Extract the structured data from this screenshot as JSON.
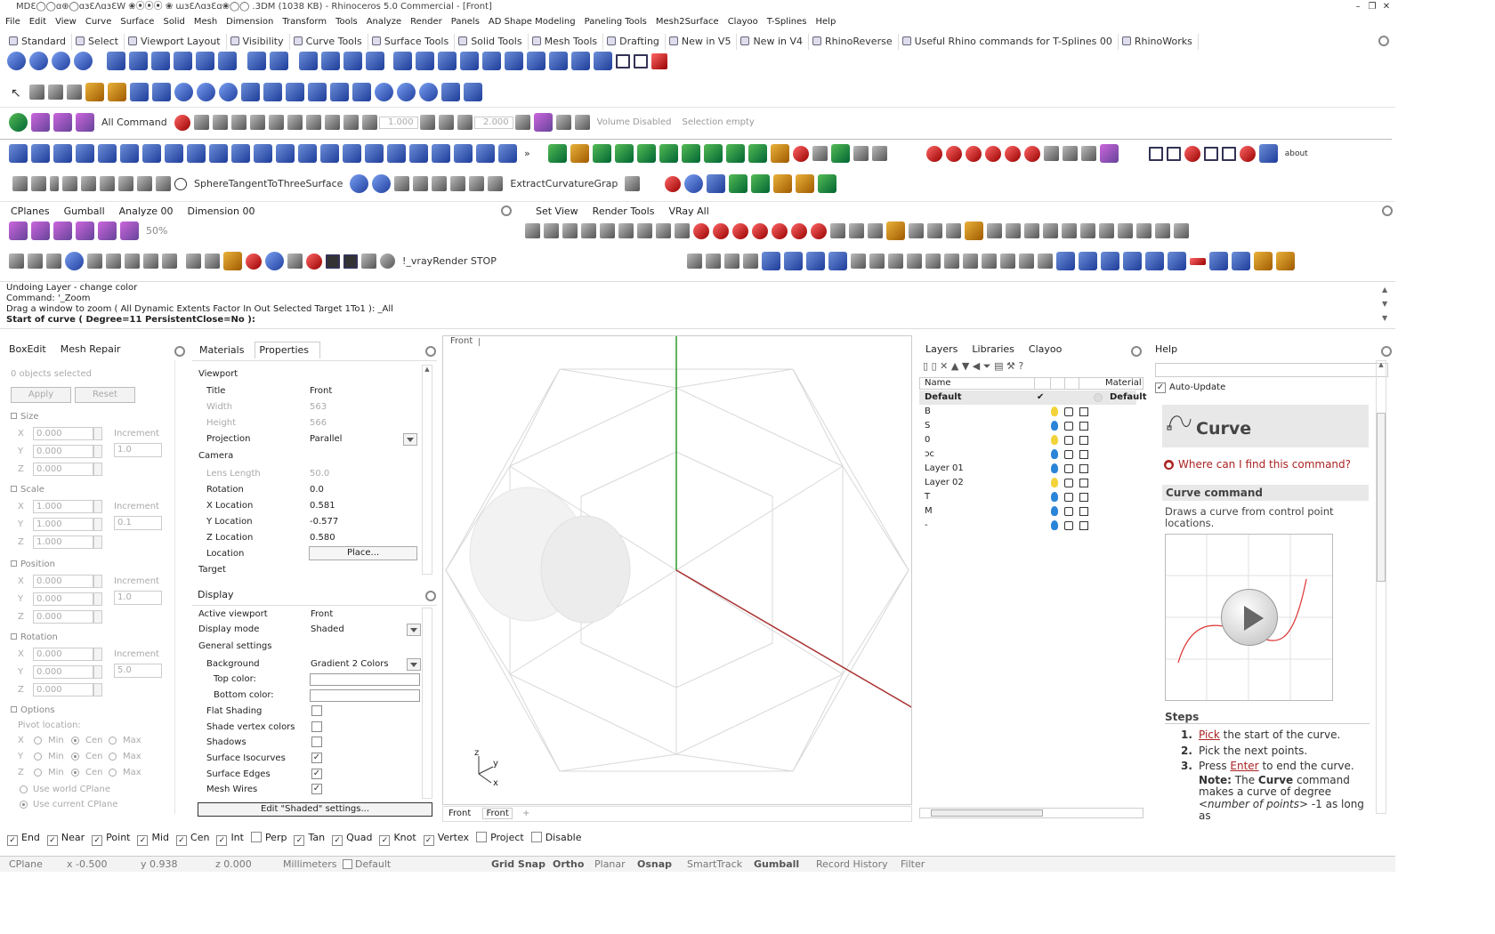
{
  "window": {
    "title": "MDƐ◯◯ɑ⊕◯ɑɜƐΛɑɜƐW ❀⦿⦿⦿ ❀ ɯɜƐΛɑɜƐɑ❀◯◯ .3DM  (1038 KB) - Rhinoceros 5.0 Commercial - [Front]",
    "minimize": "–",
    "maximize": "❐",
    "close": "✕"
  },
  "menu": [
    "File",
    "Edit",
    "View",
    "Curve",
    "Surface",
    "Solid",
    "Mesh",
    "Dimension",
    "Transform",
    "Tools",
    "Analyze",
    "Render",
    "Panels",
    "AD Shape Modeling",
    "Paneling Tools",
    "Mesh2Surface",
    "Clayoo",
    "T-Splines",
    "Help"
  ],
  "toolbar_tabs": [
    "Standard",
    "Select",
    "Viewport Layout",
    "Visibility",
    "Curve Tools",
    "Surface Tools",
    "Solid Tools",
    "Mesh Tools",
    "Drafting",
    "New in V5",
    "New in V4",
    "RhinoReverse",
    "Useful Rhino commands for T-Splines 00",
    "RhinoWorks"
  ],
  "toolbar_text": {
    "all_command": "All Command",
    "val_1000": "1.000",
    "val_2000": "2.000",
    "volume": "Volume Disabled",
    "selection": "Selection empty",
    "sphere_tangent": "SphereTangentToThreeSurface",
    "extract": "ExtractCurvatureGrap",
    "about": "about",
    "percent": "50%",
    "vray_stop": "!_vrayRender STOP"
  },
  "secondary_tabs_left": [
    "CPlanes",
    "Gumball",
    "Analyze 00",
    "Dimension 00"
  ],
  "secondary_tabs_right": [
    "Set View",
    "Render Tools",
    "VRay All"
  ],
  "command_history": [
    "Undoing Layer - change color",
    "Command: '_Zoom",
    "Drag a window to zoom ( All  Dynamic  Extents  Factor  In  Out  Selected  Target  1To1 ): _All",
    "Start of curve ( Degree=11  PersistentClose=No ):"
  ],
  "left_panel": {
    "tabs": [
      "BoxEdit",
      "Mesh Repair"
    ],
    "selected": "0 objects selected",
    "apply": "Apply",
    "reset": "Reset",
    "size": "Size",
    "scale": "Scale",
    "position": "Position",
    "rotation": "Rotation",
    "options": "Options",
    "increment": "Increment",
    "x": "X",
    "y": "Y",
    "z": "Z",
    "size_vals": [
      "0.000",
      "0.000",
      "0.000"
    ],
    "size_inc": "1.0",
    "scale_vals": [
      "1.000",
      "1.000",
      "1.000"
    ],
    "scale_inc": "0.1",
    "pos_vals": [
      "0.000",
      "0.000",
      "0.000"
    ],
    "pos_inc": "1.0",
    "rot_vals": [
      "0.000",
      "0.000",
      "0.000"
    ],
    "rot_inc": "5.0",
    "pivot": "Pivot location:",
    "min": "Min",
    "cen": "Cen",
    "max": "Max",
    "world": "Use world CPlane",
    "current": "Use current CPlane"
  },
  "properties_panel": {
    "tabs": [
      "Materials",
      "Properties"
    ],
    "viewport_header": "Viewport",
    "rows": [
      {
        "k": "Title",
        "v": "Front",
        "dis": false
      },
      {
        "k": "Width",
        "v": "563",
        "dis": true
      },
      {
        "k": "Height",
        "v": "566",
        "dis": true
      },
      {
        "k": "Projection",
        "v": "Parallel",
        "dis": false
      }
    ],
    "camera_header": "Camera",
    "camera_rows": [
      {
        "k": "Lens Length",
        "v": "50.0",
        "dis": true
      },
      {
        "k": "Rotation",
        "v": "0.0",
        "dis": false
      },
      {
        "k": "X Location",
        "v": "0.581",
        "dis": false
      },
      {
        "k": "Y Location",
        "v": "-0.577",
        "dis": false
      },
      {
        "k": "Z Location",
        "v": "0.580",
        "dis": false
      }
    ],
    "location": "Location",
    "place_btn": "Place...",
    "target": "Target"
  },
  "display_panel": {
    "tab": "Display",
    "active_viewport_k": "Active viewport",
    "active_viewport_v": "Front",
    "display_mode_k": "Display mode",
    "display_mode_v": "Shaded",
    "general": "General settings",
    "background_k": "Background",
    "background_v": "Gradient 2 Colors",
    "top_color": "Top color:",
    "bottom_color": "Bottom color:",
    "checks": [
      {
        "label": "Flat Shading",
        "on": false
      },
      {
        "label": "Shade vertex colors",
        "on": false
      },
      {
        "label": "Shadows",
        "on": false
      },
      {
        "label": "Surface Isocurves",
        "on": true
      },
      {
        "label": "Surface Edges",
        "on": true
      },
      {
        "label": "Mesh Wires",
        "on": true
      }
    ],
    "edit_btn": "Edit \"Shaded\" settings..."
  },
  "viewport": {
    "label": "Front",
    "tab1": "Front",
    "tab2": "Front",
    "add": "+",
    "axis_x": "x",
    "axis_y": "y",
    "axis_z": "z"
  },
  "layers_panel": {
    "tabs": [
      "Layers",
      "Libraries",
      "Clayoo"
    ],
    "col_name": "Name",
    "col_material": "Material",
    "default_name": "Default",
    "default_material": "Default",
    "check": "✔",
    "layers": [
      {
        "name": "B",
        "bulb": "#f2d33a"
      },
      {
        "name": "S",
        "bulb": "#2a84d8"
      },
      {
        "name": "0",
        "bulb": "#f2d33a"
      },
      {
        "name": "ɔc",
        "bulb": "#2a84d8"
      },
      {
        "name": "Layer 01",
        "bulb": "#2a84d8"
      },
      {
        "name": "Layer 02",
        "bulb": "#f2d33a"
      },
      {
        "name": "T",
        "bulb": "#2a84d8"
      },
      {
        "name": "M",
        "bulb": "#2a84d8"
      },
      {
        "name": "-",
        "bulb": "#2a84d8"
      }
    ]
  },
  "help_panel": {
    "tab": "Help",
    "auto_update": "Auto-Update",
    "title": "Curve",
    "where": "Where can I find this command?",
    "cmd_header": "Curve command",
    "desc": "Draws a curve from control point locations.",
    "steps_header": "Steps",
    "step1_link": "Pick",
    "step1_rest": " the start of the curve.",
    "step2": "Pick the next points.",
    "step3_pre": "Press ",
    "step3_link": "Enter",
    "step3_rest": " to end the curve.",
    "note_label": "Note:",
    "note_pre": " The ",
    "note_bold": "Curve",
    "note_mid": " command makes a curve of degree ",
    "note_it": "<number of points>",
    "note_end": " -1 as long as"
  },
  "osnap": [
    {
      "label": "End",
      "on": true
    },
    {
      "label": "Near",
      "on": true
    },
    {
      "label": "Point",
      "on": true
    },
    {
      "label": "Mid",
      "on": true
    },
    {
      "label": "Cen",
      "on": true
    },
    {
      "label": "Int",
      "on": true
    },
    {
      "label": "Perp",
      "on": false
    },
    {
      "label": "Tan",
      "on": true
    },
    {
      "label": "Quad",
      "on": true
    },
    {
      "label": "Knot",
      "on": true
    },
    {
      "label": "Vertex",
      "on": true
    },
    {
      "label": "Project",
      "on": false
    },
    {
      "label": "Disable",
      "on": false
    }
  ],
  "status": {
    "cplane": "CPlane",
    "x": "x -0.500",
    "y": "y 0.938",
    "z": "z 0.000",
    "units": "Millimeters",
    "layer": "Default",
    "grid_snap": "Grid Snap",
    "ortho": "Ortho",
    "planar": "Planar",
    "osnap": "Osnap",
    "smarttrack": "SmartTrack",
    "gumball": "Gumball",
    "record": "Record History",
    "filter": "Filter"
  }
}
